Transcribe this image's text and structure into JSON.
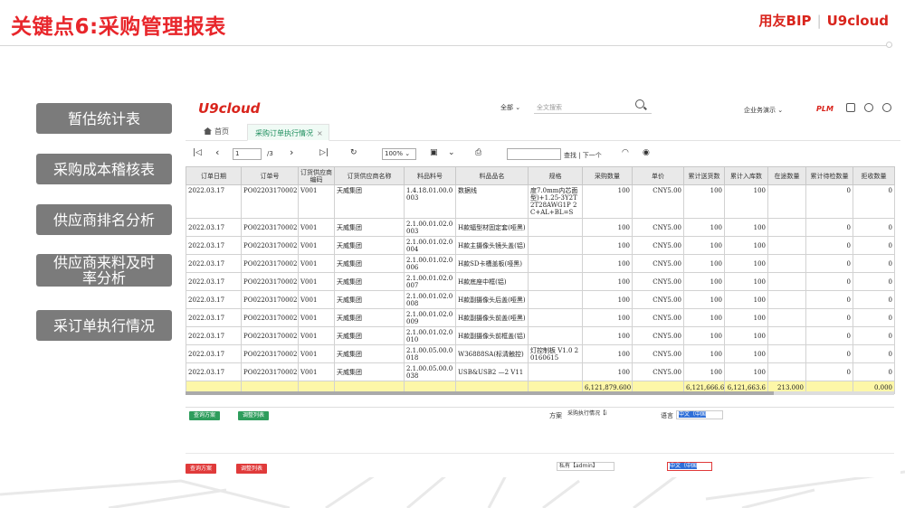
{
  "slide": {
    "title": "关键点6:采购管理报表",
    "brand_left": "用友BIP",
    "brand_right": "U9cloud"
  },
  "nav": [
    {
      "label": "暂估统计表"
    },
    {
      "label": "采购成本稽核表"
    },
    {
      "label": "供应商排名分析"
    },
    {
      "label": "供应商来料及时率分析"
    },
    {
      "label": "采订单执行情况"
    }
  ],
  "app": {
    "logo": "U9cloud",
    "scope": "全部",
    "search_placeholder": "全文搜索",
    "org": "企业务演示",
    "plm": "PLM",
    "tabs": {
      "home": "首页",
      "active": "采购订单执行情况"
    },
    "toolbar": {
      "page": "1",
      "page_total": "/3",
      "zoom": "100%",
      "find_label": "查找 | 下一个"
    },
    "columns": [
      "订单日期",
      "订单号",
      "订货供应商编码",
      "订货供应商名称",
      "料品料号",
      "料品品名",
      "规格",
      "采购数量",
      "单价",
      "累计送货数",
      "累计入库数",
      "在途数量",
      "累计待检数量",
      "拒收数量"
    ],
    "rows": [
      {
        "date": "2022.03.17",
        "order": "PO02203170002",
        "code": "V001",
        "vendor": "天威集团",
        "item_no": "1.4.18.01.00.0003",
        "item_name": "数据线",
        "spec": "度7.0mm内芯面型)+1.25-3Y2T2T28AWG1P 2C+AL+BL=S",
        "qty": "100",
        "price": "CNY5.00",
        "delivered": "100",
        "received": "100",
        "transit": "",
        "pending": "0",
        "rejected": "0"
      },
      {
        "date": "2022.03.17",
        "order": "PO02203170002",
        "code": "V001",
        "vendor": "天威集团",
        "item_no": "2.1.00.01.02.0003",
        "item_name": "H款辐型材固定套(哑黑)",
        "spec": "",
        "qty": "100",
        "price": "CNY5.00",
        "delivered": "100",
        "received": "100",
        "transit": "",
        "pending": "0",
        "rejected": "0"
      },
      {
        "date": "2022.03.17",
        "order": "PO02203170002",
        "code": "V001",
        "vendor": "天威集团",
        "item_no": "2.1.00.01.02.0004",
        "item_name": "H款主摄像头镜头盖(铝)",
        "spec": "",
        "qty": "100",
        "price": "CNY5.00",
        "delivered": "100",
        "received": "100",
        "transit": "",
        "pending": "0",
        "rejected": "0"
      },
      {
        "date": "2022.03.17",
        "order": "PO02203170002",
        "code": "V001",
        "vendor": "天威集团",
        "item_no": "2.1.00.01.02.0006",
        "item_name": "H款SD卡槽盖板(哑黑)",
        "spec": "",
        "qty": "100",
        "price": "CNY5.00",
        "delivered": "100",
        "received": "100",
        "transit": "",
        "pending": "0",
        "rejected": "0"
      },
      {
        "date": "2022.03.17",
        "order": "PO02203170002",
        "code": "V001",
        "vendor": "天威集团",
        "item_no": "2.1.00.01.02.0007",
        "item_name": "H款底座中框(铝)",
        "spec": "",
        "qty": "100",
        "price": "CNY5.00",
        "delivered": "100",
        "received": "100",
        "transit": "",
        "pending": "0",
        "rejected": "0"
      },
      {
        "date": "2022.03.17",
        "order": "PO02203170002",
        "code": "V001",
        "vendor": "天威集团",
        "item_no": "2.1.00.01.02.0008",
        "item_name": "H款副摄像头后盖(哑黑)",
        "spec": "",
        "qty": "100",
        "price": "CNY5.00",
        "delivered": "100",
        "received": "100",
        "transit": "",
        "pending": "0",
        "rejected": "0"
      },
      {
        "date": "2022.03.17",
        "order": "PO02203170002",
        "code": "V001",
        "vendor": "天威集团",
        "item_no": "2.1.00.01.02.0009",
        "item_name": "H款副摄像头前盖(哑黑)",
        "spec": "",
        "qty": "100",
        "price": "CNY5.00",
        "delivered": "100",
        "received": "100",
        "transit": "",
        "pending": "0",
        "rejected": "0"
      },
      {
        "date": "2022.03.17",
        "order": "PO02203170002",
        "code": "V001",
        "vendor": "天威集团",
        "item_no": "2.1.00.01.02.0010",
        "item_name": "H款副摄像头前框盖(铝)",
        "spec": "",
        "qty": "100",
        "price": "CNY5.00",
        "delivered": "100",
        "received": "100",
        "transit": "",
        "pending": "0",
        "rejected": "0"
      },
      {
        "date": "2022.03.17",
        "order": "PO02203170002",
        "code": "V001",
        "vendor": "天威集团",
        "item_no": "2.1.00.05.00.0018",
        "item_name": "W36888SA(标清触控)",
        "spec": "灯控制板 V1.0 20160615",
        "qty": "100",
        "price": "CNY5.00",
        "delivered": "100",
        "received": "100",
        "transit": "",
        "pending": "0",
        "rejected": "0"
      },
      {
        "date": "2022.03.17",
        "order": "PO02203170002",
        "code": "V001",
        "vendor": "天威集团",
        "item_no": "2.1.00.05.00.0038",
        "item_name": "USB&USB2 —2 V11",
        "spec": "",
        "qty": "100",
        "price": "CNY5.00",
        "delivered": "100",
        "received": "100",
        "transit": "",
        "pending": "0",
        "rejected": "0"
      }
    ],
    "totals": {
      "qty": "6,121,879.600",
      "delivered": "6,121,666.6",
      "received": "6,121,663.6",
      "transit": "213.000",
      "rejected": "0.000"
    },
    "panel": {
      "btn_query": "查询方案",
      "btn_layout": "调整列表",
      "scheme_label": "方案",
      "scheme_value": "采购执行情况【i",
      "lang_label": "语言",
      "lang_value": "中文（中国"
    },
    "bottom": {
      "btn_query": "查询方案",
      "btn_layout": "调整列表",
      "private_value": "私有【admin】",
      "lang_value": "中文（中国"
    }
  }
}
